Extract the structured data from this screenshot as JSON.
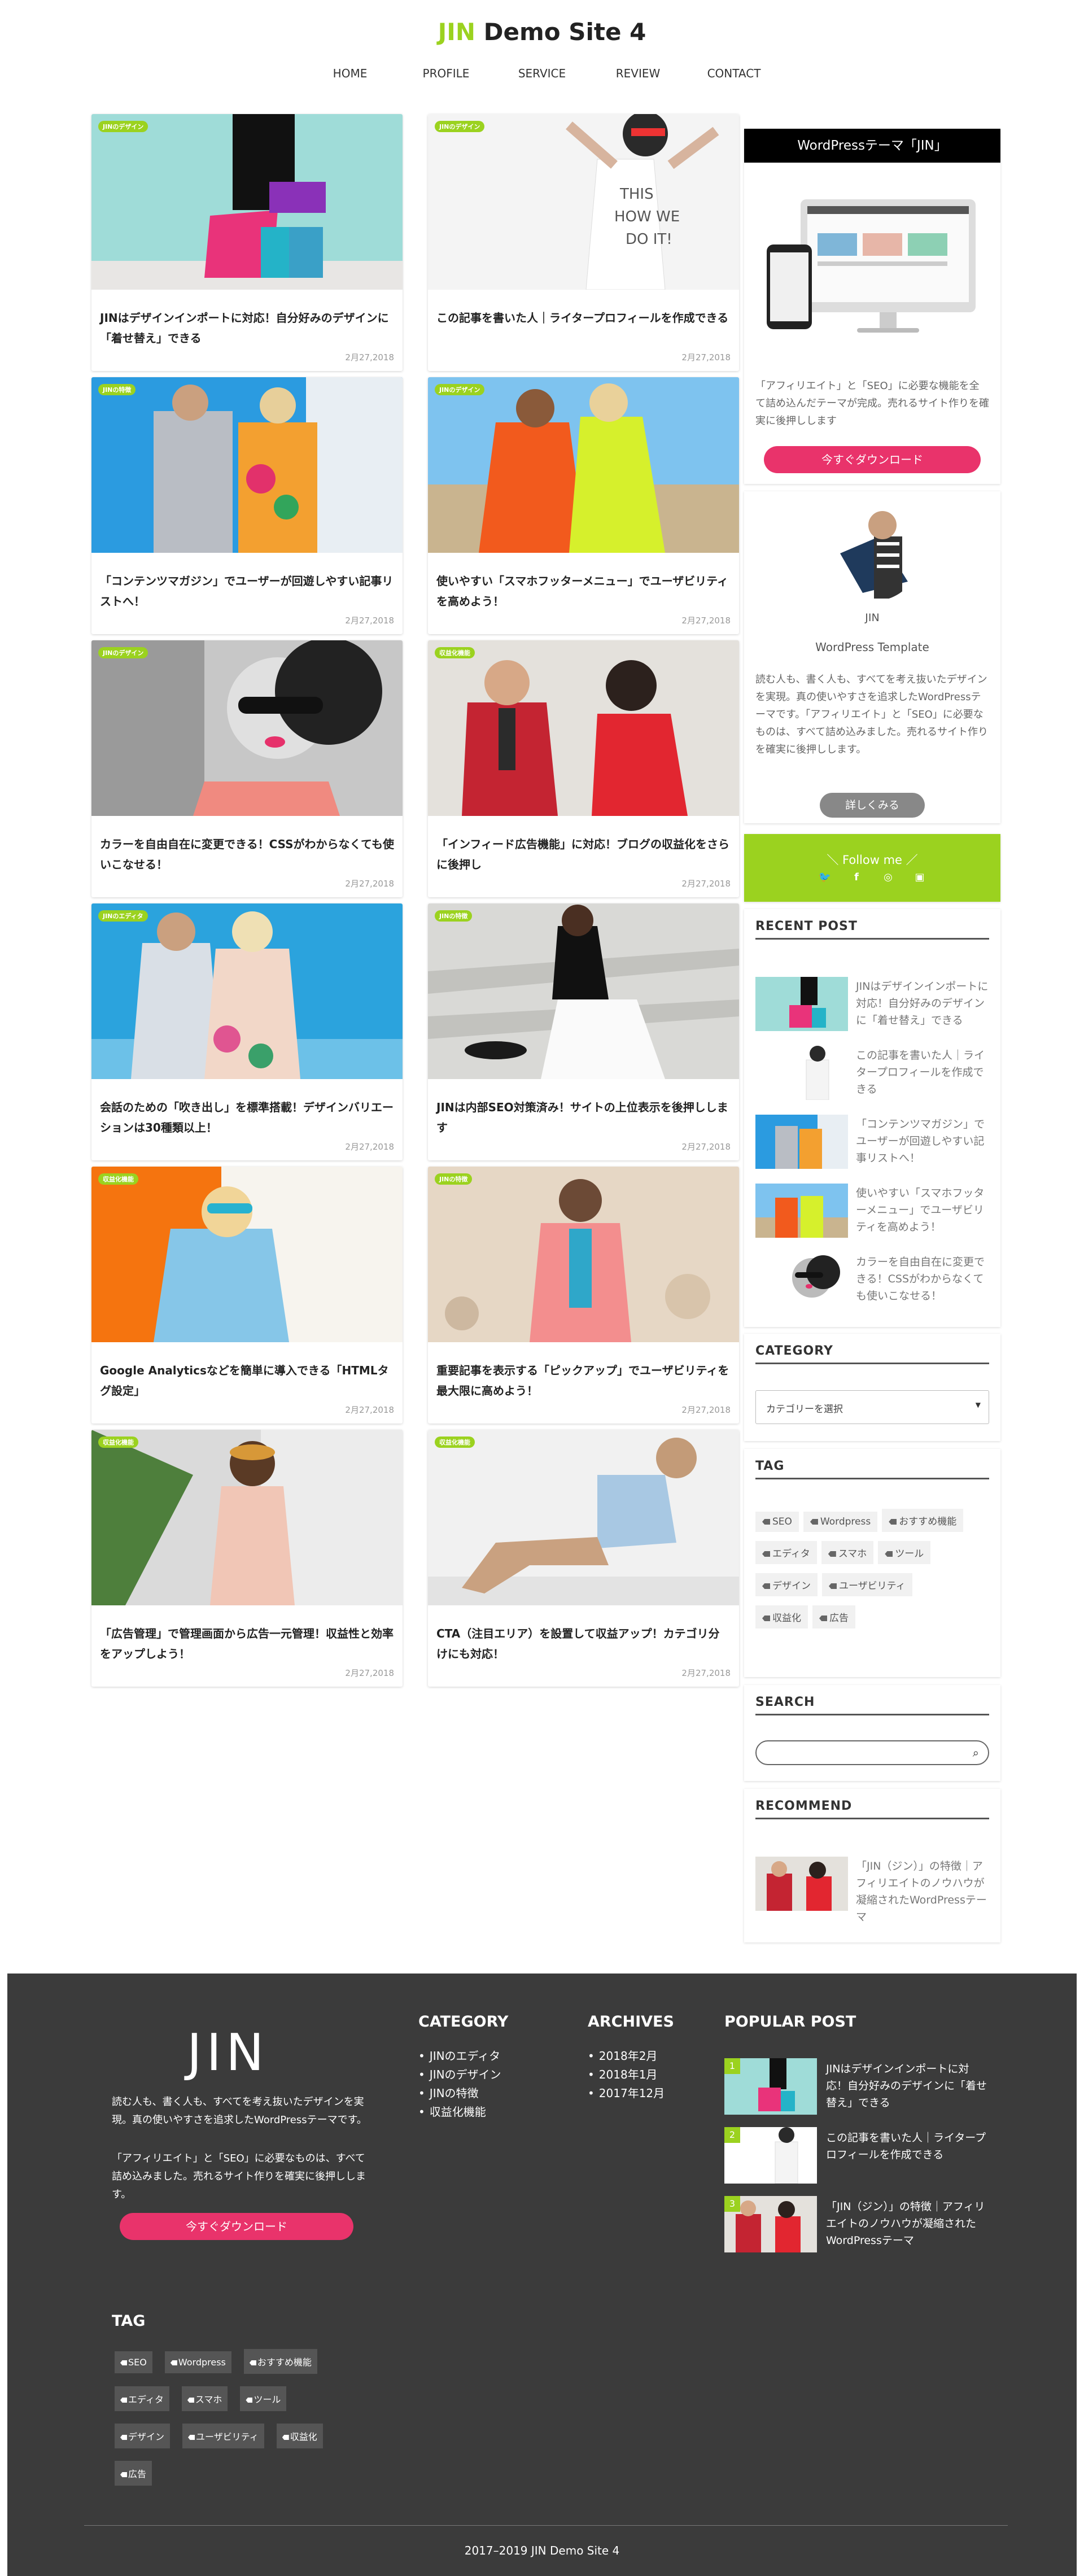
{
  "header": {
    "title_accent": "JIN",
    "title_rest": " Demo Site 4"
  },
  "nav": [
    "HOME",
    "PROFILE",
    "SERVICE",
    "REVIEW",
    "CONTACT"
  ],
  "posts": [
    {
      "category": "JINのデザイン",
      "title": "JINはデザインインポートに対応！自分好みのデザインに「着せ替え」できる",
      "date": "2月27,2018"
    },
    {
      "category": "JINのデザイン",
      "title": "この記事を書いた人｜ライタープロフィールを作成できる",
      "date": "2月27,2018"
    },
    {
      "category": "JINの特徴",
      "title": "「コンテンツマガジン」でユーザーが回遊しやすい記事リストへ！",
      "date": "2月27,2018"
    },
    {
      "category": "JINのデザイン",
      "title": "使いやすい「スマホフッターメニュー」でユーザビリティを高めよう！",
      "date": "2月27,2018"
    },
    {
      "category": "JINのデザイン",
      "title": "カラーを自由自在に変更できる！CSSがわからなくても使いこなせる！",
      "date": "2月27,2018"
    },
    {
      "category": "収益化機能",
      "title": "「インフィード広告機能」に対応！ブログの収益化をさらに後押し",
      "date": "2月27,2018"
    },
    {
      "category": "JINのエディタ",
      "title": "会話のための「吹き出し」を標準搭載！デザインバリエーションは30種類以上！",
      "date": "2月27,2018"
    },
    {
      "category": "JINの特徴",
      "title": "JINは内部SEO対策済み！サイトの上位表示を後押しします",
      "date": "2月27,2018"
    },
    {
      "category": "収益化機能",
      "title": "Google Analyticsなどを簡単に導入できる「HTMLタグ設定」",
      "date": "2月27,2018"
    },
    {
      "category": "JINの特徴",
      "title": "重要記事を表示する「ピックアップ」でユーザビリティを最大限に高めよう！",
      "date": "2月27,2018"
    },
    {
      "category": "収益化機能",
      "title": "「広告管理」で管理画面から広告一元管理！収益性と効率をアップしよう！",
      "date": "2月27,2018"
    },
    {
      "category": "収益化機能",
      "title": "CTA（注目エリア）を設置して収益アップ！カテゴリ分けにも対応！",
      "date": "2月27,2018"
    }
  ],
  "sidebar": {
    "promo_title": "WordPressテーマ「JIN」",
    "promo_text": "「アフィリエイト」と「SEO」に必要な機能を全て詰め込んだテーマが完成。売れるサイト作りを確実に後押しします",
    "promo_button": "今すぐダウンロード",
    "profile_name": "JIN",
    "profile_subtitle": "WordPress Template",
    "profile_text": "読む人も、書く人も、すべてを考え抜いたデザインを実現。真の使いやすさを追求したWordPressテーマです。「アフィリエイト」と「SEO」に必要なものは、すべて詰め込みました。売れるサイト作りを確実に後押しします。",
    "profile_button": "詳しくみる",
    "follow_title": "＼ Follow me ／",
    "recent_title": "RECENT POST",
    "recent": [
      "JINはデザインインポートに対応！自分好みのデザインに「着せ替え」できる",
      "この記事を書いた人｜ライタープロフィールを作成できる",
      "「コンテンツマガジン」でユーザーが回遊しやすい記事リストへ！",
      "使いやすい「スマホフッターメニュー」でユーザビリティを高めよう！",
      "カラーを自由自在に変更できる！CSSがわからなくても使いこなせる！"
    ],
    "category_title": "CATEGORY",
    "category_select": "カテゴリーを選択",
    "tag_title": "TAG",
    "tags": [
      "SEO",
      "Wordpress",
      "おすすめ機能",
      "エディタ",
      "スマホ",
      "ツール",
      "デザイン",
      "ユーザビリティ",
      "収益化",
      "広告"
    ],
    "search_title": "SEARCH",
    "recommend_title": "RECOMMEND",
    "recommend_text": "「JIN（ジン）」の特徴｜アフィリエイトのノウハウが凝縮されたWordPressテーマ"
  },
  "footer": {
    "logo": "JIN",
    "text1": "読む人も、書く人も、すべてを考え抜いたデザインを実現。真の使いやすさを追求したWordPressテーマです。",
    "text2": "「アフィリエイト」と「SEO」に必要なものは、すべて詰め込みました。売れるサイト作りを確実に後押しします。",
    "button": "今すぐダウンロード",
    "category_title": "CATEGORY",
    "categories": [
      "JINのエディタ",
      "JINのデザイン",
      "JINの特徴",
      "収益化機能"
    ],
    "archives_title": "ARCHIVES",
    "archives": [
      "2018年2月",
      "2018年1月",
      "2017年12月"
    ],
    "popular_title": "POPULAR POST",
    "popular": [
      {
        "num": "1",
        "title": "JINはデザインインポートに対応！自分好みのデザインに「着せ替え」できる"
      },
      {
        "num": "2",
        "title": "この記事を書いた人｜ライタープロフィールを作成できる"
      },
      {
        "num": "3",
        "title": "「JIN（ジン）」の特徴｜アフィリエイトのノウハウが凝縮されたWordPressテーマ"
      }
    ],
    "tag_title": "TAG",
    "tags": [
      "SEO",
      "Wordpress",
      "おすすめ機能",
      "エディタ",
      "スマホ",
      "ツール",
      "デザイン",
      "ユーザビリティ",
      "収益化",
      "広告"
    ],
    "copyright": "2017–2019 JIN Demo Site 4"
  }
}
